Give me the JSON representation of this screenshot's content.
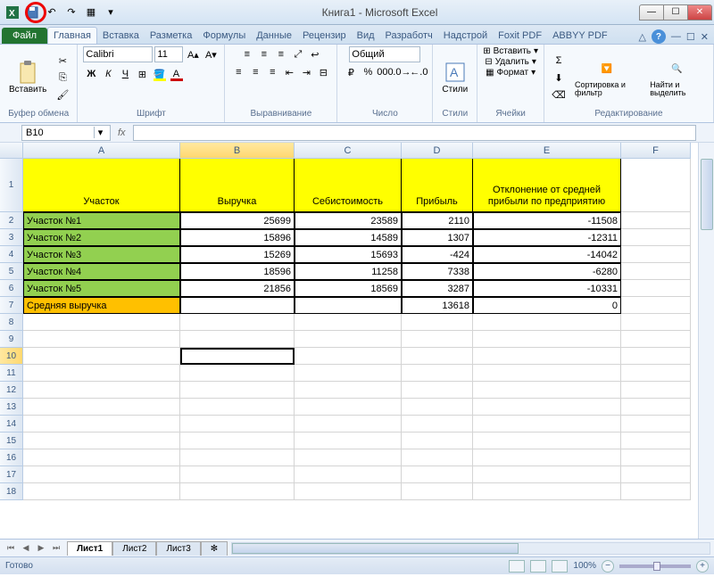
{
  "title": "Книга1 - Microsoft Excel",
  "tabs": {
    "file": "Файл",
    "list": [
      "Главная",
      "Вставка",
      "Разметка",
      "Формулы",
      "Данные",
      "Рецензир",
      "Вид",
      "Разработч",
      "Надстрой",
      "Foxit PDF",
      "ABBYY PDF"
    ],
    "active": 0
  },
  "ribbon": {
    "clipboard": {
      "label": "Буфер обмена",
      "paste": "Вставить"
    },
    "font": {
      "label": "Шрифт",
      "name": "Calibri",
      "size": "11"
    },
    "align": {
      "label": "Выравнивание"
    },
    "number": {
      "label": "Число",
      "format": "Общий"
    },
    "styles": {
      "label": "Стили",
      "btn": "Стили"
    },
    "cells": {
      "label": "Ячейки",
      "insert": "Вставить",
      "delete": "Удалить",
      "format": "Формат"
    },
    "editing": {
      "label": "Редактирование",
      "sort": "Сортировка и фильтр",
      "find": "Найти и выделить"
    }
  },
  "namebox": "B10",
  "columns": [
    "A",
    "B",
    "C",
    "D",
    "E",
    "F"
  ],
  "rownums": [
    "1",
    "2",
    "3",
    "4",
    "5",
    "6",
    "7",
    "8",
    "9",
    "10",
    "11",
    "12",
    "13",
    "14",
    "15",
    "16",
    "17",
    "18"
  ],
  "headers": {
    "A": "Участок",
    "B": "Выручка",
    "C": "Себистоимость",
    "D": "Прибыль",
    "E": "Отклонение от средней прибыли по предприятию"
  },
  "data": [
    {
      "A": "Участок №1",
      "B": "25699",
      "C": "23589",
      "D": "2110",
      "E": "-11508"
    },
    {
      "A": "Участок №2",
      "B": "15896",
      "C": "14589",
      "D": "1307",
      "E": "-12311"
    },
    {
      "A": "Участок №3",
      "B": "15269",
      "C": "15693",
      "D": "-424",
      "E": "-14042"
    },
    {
      "A": "Участок №4",
      "B": "18596",
      "C": "11258",
      "D": "7338",
      "E": "-6280"
    },
    {
      "A": "Участок №5",
      "B": "21856",
      "C": "18569",
      "D": "3287",
      "E": "-10331"
    }
  ],
  "summary": {
    "A": "Средняя выручка",
    "D": "13618",
    "E": "0"
  },
  "sheets": [
    "Лист1",
    "Лист2",
    "Лист3"
  ],
  "status": {
    "ready": "Готово",
    "zoom": "100%"
  }
}
